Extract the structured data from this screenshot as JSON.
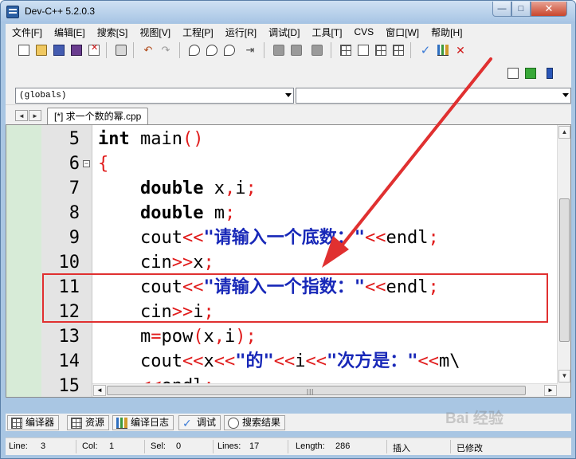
{
  "window": {
    "title": "Dev-C++ 5.2.0.3",
    "minimize": "—",
    "maximize": "□",
    "close": "✕"
  },
  "menu": [
    "文件[F]",
    "编辑[E]",
    "搜索[S]",
    "视图[V]",
    "工程[P]",
    "运行[R]",
    "调试[D]",
    "工具[T]",
    "CVS",
    "窗口[W]",
    "帮助[H]"
  ],
  "toolbar": {
    "undo": "↶",
    "redo": "↷",
    "indent": "⇥"
  },
  "scope_combo": {
    "value": "(globals)"
  },
  "member_combo": {
    "value": ""
  },
  "tabs": [
    {
      "label": "[*] 求一个数的幂.cpp"
    }
  ],
  "tab_nav": {
    "left": "◄",
    "right": "►"
  },
  "editor": {
    "fold_symbol": "⊟",
    "lines": [
      {
        "num": "5",
        "tokens": [
          {
            "t": "int",
            "c": "kw"
          },
          {
            "t": " main",
            "c": ""
          },
          {
            "t": "()",
            "c": "op"
          }
        ]
      },
      {
        "num": "6",
        "tokens": [
          {
            "t": "{",
            "c": "op"
          }
        ]
      },
      {
        "num": "7",
        "tokens": [
          {
            "t": "    ",
            "c": ""
          },
          {
            "t": "double",
            "c": "kw"
          },
          {
            "t": " x",
            "c": ""
          },
          {
            "t": ",",
            "c": "op"
          },
          {
            "t": "i",
            "c": ""
          },
          {
            "t": ";",
            "c": "op"
          }
        ]
      },
      {
        "num": "8",
        "tokens": [
          {
            "t": "    ",
            "c": ""
          },
          {
            "t": "double",
            "c": "kw"
          },
          {
            "t": " m",
            "c": ""
          },
          {
            "t": ";",
            "c": "op"
          }
        ]
      },
      {
        "num": "9",
        "tokens": [
          {
            "t": "    cout",
            "c": ""
          },
          {
            "t": "<<",
            "c": "op"
          },
          {
            "t": "\"请输入一个底数：\"",
            "c": "str"
          },
          {
            "t": "<<",
            "c": "op"
          },
          {
            "t": "endl",
            "c": ""
          },
          {
            "t": ";",
            "c": "op"
          }
        ]
      },
      {
        "num": "10",
        "tokens": [
          {
            "t": "    cin",
            "c": ""
          },
          {
            "t": ">>",
            "c": "op"
          },
          {
            "t": "x",
            "c": ""
          },
          {
            "t": ";",
            "c": "op"
          }
        ]
      },
      {
        "num": "11",
        "tokens": [
          {
            "t": "    cout",
            "c": ""
          },
          {
            "t": "<<",
            "c": "op"
          },
          {
            "t": "\"请输入一个指数：\"",
            "c": "str"
          },
          {
            "t": "<<",
            "c": "op"
          },
          {
            "t": "endl",
            "c": ""
          },
          {
            "t": ";",
            "c": "op"
          }
        ]
      },
      {
        "num": "12",
        "tokens": [
          {
            "t": "    cin",
            "c": ""
          },
          {
            "t": ">>",
            "c": "op"
          },
          {
            "t": "i",
            "c": ""
          },
          {
            "t": ";",
            "c": "op"
          }
        ]
      },
      {
        "num": "13",
        "tokens": [
          {
            "t": "    m",
            "c": ""
          },
          {
            "t": "=",
            "c": "op"
          },
          {
            "t": "pow",
            "c": ""
          },
          {
            "t": "(",
            "c": "op"
          },
          {
            "t": "x",
            "c": ""
          },
          {
            "t": ",",
            "c": "op"
          },
          {
            "t": "i",
            "c": ""
          },
          {
            "t": ");",
            "c": "op"
          }
        ]
      },
      {
        "num": "14",
        "tokens": [
          {
            "t": "    cout",
            "c": ""
          },
          {
            "t": "<<",
            "c": "op"
          },
          {
            "t": "x",
            "c": ""
          },
          {
            "t": "<<",
            "c": "op"
          },
          {
            "t": "\"的\"",
            "c": "str"
          },
          {
            "t": "<<",
            "c": "op"
          },
          {
            "t": "i",
            "c": ""
          },
          {
            "t": "<<",
            "c": "op"
          },
          {
            "t": "\"次方是：\"",
            "c": "str"
          },
          {
            "t": "<<",
            "c": "op"
          },
          {
            "t": "m\\",
            "c": ""
          }
        ]
      },
      {
        "num": "15",
        "tokens": [
          {
            "t": "    ",
            "c": ""
          },
          {
            "t": "<<",
            "c": "op"
          },
          {
            "t": "endl",
            "c": ""
          },
          {
            "t": ";",
            "c": "op"
          }
        ]
      }
    ]
  },
  "scrollbars": {
    "up": "▲",
    "down": "▼",
    "left": "◄",
    "right": "►",
    "grip": "|||"
  },
  "bottom_tabs": [
    {
      "label": "编译器",
      "icon": "grid"
    },
    {
      "label": "资源",
      "icon": "grid"
    },
    {
      "label": "编译日志",
      "icon": "bars"
    },
    {
      "label": "调试",
      "icon": "check"
    },
    {
      "label": "搜索结果",
      "icon": "find"
    }
  ],
  "status": {
    "line_label": "Line:",
    "line": "3",
    "col_label": "Col:",
    "col": "1",
    "sel_label": "Sel:",
    "sel": "0",
    "lines_label": "Lines:",
    "lines": "17",
    "length_label": "Length:",
    "length": "286",
    "mode": "插入",
    "modified": "已修改"
  },
  "watermark": "Bai 经验",
  "colors": {
    "annotation": "#e03030",
    "operator": "#e01a1a",
    "string": "#1828b8",
    "fold_strip": "#d7ebd7"
  }
}
